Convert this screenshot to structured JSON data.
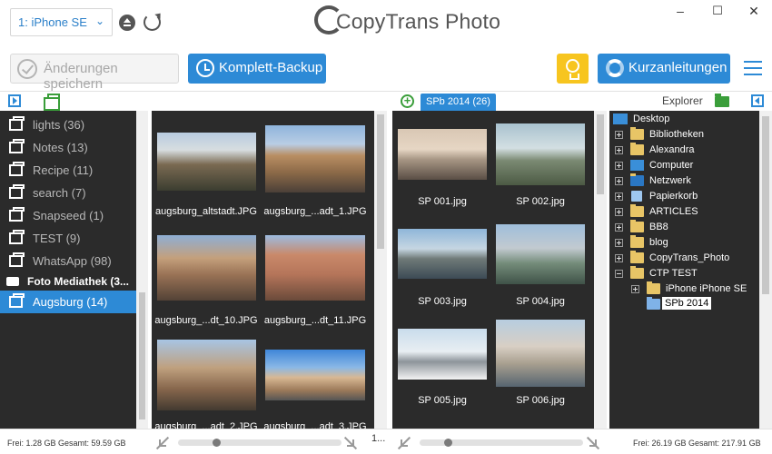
{
  "device": {
    "selected": "1: iPhone SE"
  },
  "app": {
    "logo_text": "CopyTrans Photo"
  },
  "window": {
    "minimize": "–",
    "maximize": "☐",
    "close": "✕"
  },
  "toolbar": {
    "save_label": "Änderungen speichern",
    "backup_label": "Komplett-Backup",
    "guides_label": "Kurzanleitungen"
  },
  "colors": {
    "accent": "#2d8ad6",
    "panel_bg": "#2b2b2b",
    "green": "#3a9e3a",
    "bulb": "#f7c51f"
  },
  "albums": [
    {
      "label": "lights (36)"
    },
    {
      "label": "Notes (13)"
    },
    {
      "label": "Recipe (11)"
    },
    {
      "label": "search (7)"
    },
    {
      "label": "Snapseed (1)"
    },
    {
      "label": "TEST (9)"
    },
    {
      "label": "WhatsApp (98)"
    }
  ],
  "library_header": "Foto Mediathek (3...",
  "selected_album": "Augsburg (14)",
  "device_photos": [
    {
      "name": "augsburg_altstadt.JPG"
    },
    {
      "name": "augsburg_...adt_1.JPG"
    },
    {
      "name": "augsburg_...dt_10.JPG"
    },
    {
      "name": "augsburg_...dt_11.JPG"
    },
    {
      "name": "augsburg_...adt_2.JPG"
    },
    {
      "name": "augsburg_...adt_3.JPG"
    }
  ],
  "pc_album_tab": "SPb 2014 (26)",
  "pc_photos": [
    {
      "name": "SP 001.jpg"
    },
    {
      "name": "SP 002.jpg"
    },
    {
      "name": "SP 003.jpg"
    },
    {
      "name": "SP 004.jpg"
    },
    {
      "name": "SP 005.jpg"
    },
    {
      "name": "SP 006.jpg"
    }
  ],
  "explorer": {
    "label": "Explorer",
    "tree": [
      {
        "label": "Desktop"
      },
      {
        "label": "Bibliotheken"
      },
      {
        "label": "Alexandra"
      },
      {
        "label": "Computer"
      },
      {
        "label": "Netzwerk"
      },
      {
        "label": "Papierkorb"
      },
      {
        "label": "ARTICLES"
      },
      {
        "label": "BB8"
      },
      {
        "label": "blog"
      },
      {
        "label": "CopyTrans_Photo"
      },
      {
        "label": "CTP TEST"
      },
      {
        "label": "iPhone iPhone SE"
      },
      {
        "label": "SPb 2014"
      }
    ]
  },
  "status": {
    "device_free": "Frei: 1.28 GB Gesamt: 59.59 GB",
    "pc_free": "Frei: 26.19 GB Gesamt: 217.91 GB",
    "device_count": "1..."
  }
}
